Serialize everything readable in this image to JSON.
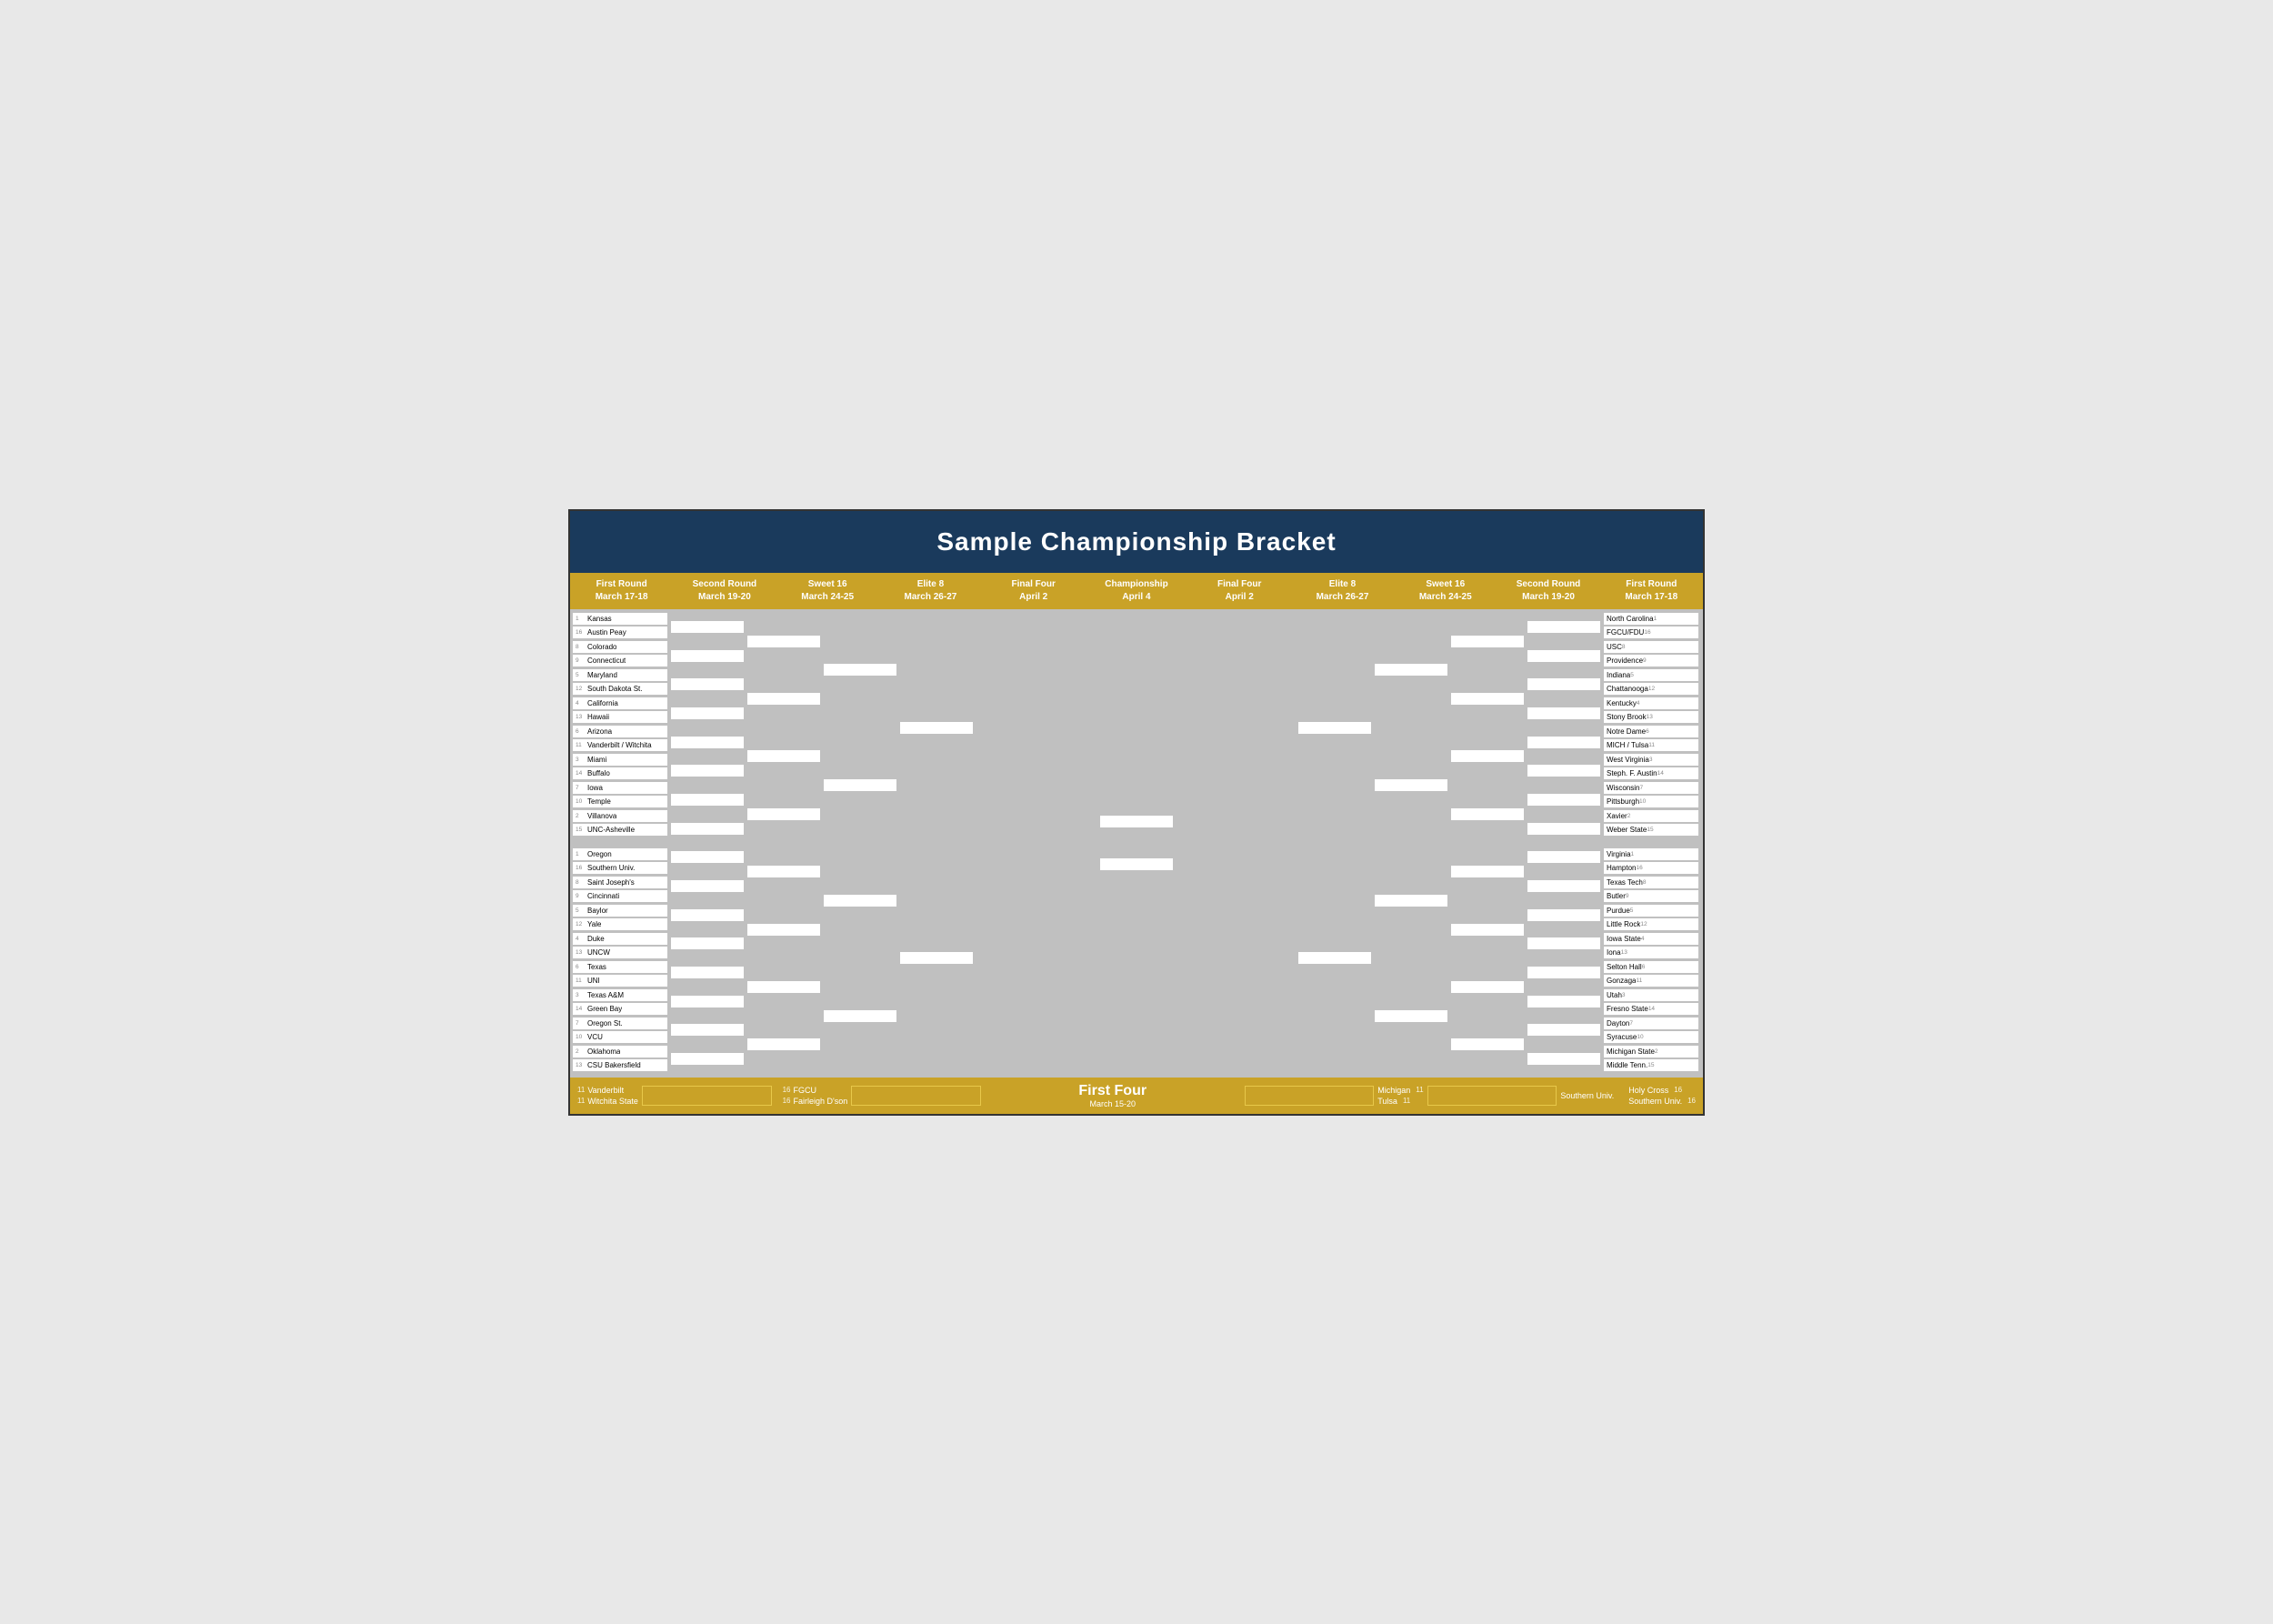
{
  "title": "Sample Championship Bracket",
  "rounds": {
    "left": [
      "First Round\nMarch 17-18",
      "Second Round\nMarch 19-20",
      "Sweet 16\nMarch 24-25",
      "Elite 8\nMarch 26-27",
      "Final Four\nApril 2",
      "Championship\nApril 4"
    ],
    "right": [
      "Final Four\nApril 2",
      "Elite 8\nMarch 26-27",
      "Sweet 16\nMarch 24-25",
      "Second Round\nMarch 19-20",
      "First Round\nMarch 17-18"
    ]
  },
  "left_top": [
    {
      "seed": 1,
      "name": "Kansas"
    },
    {
      "seed": 16,
      "name": "Austin Peay"
    },
    {
      "seed": 8,
      "name": "Colorado"
    },
    {
      "seed": 9,
      "name": "Connecticut"
    },
    {
      "seed": 5,
      "name": "Maryland"
    },
    {
      "seed": 12,
      "name": "South Dakota St."
    },
    {
      "seed": 4,
      "name": "California"
    },
    {
      "seed": 13,
      "name": "Hawaii"
    },
    {
      "seed": 6,
      "name": "Arizona"
    },
    {
      "seed": 11,
      "name": "Vanderbilt / Witchita"
    },
    {
      "seed": 3,
      "name": "Miami"
    },
    {
      "seed": 14,
      "name": "Buffalo"
    },
    {
      "seed": 7,
      "name": "Iowa"
    },
    {
      "seed": 10,
      "name": "Temple"
    },
    {
      "seed": 2,
      "name": "Villanova"
    },
    {
      "seed": 15,
      "name": "UNC-Asheville"
    }
  ],
  "left_bottom": [
    {
      "seed": 1,
      "name": "Oregon"
    },
    {
      "seed": 16,
      "name": "Southern Univ."
    },
    {
      "seed": 8,
      "name": "Saint Joseph's"
    },
    {
      "seed": 9,
      "name": "Cincinnati"
    },
    {
      "seed": 5,
      "name": "Baylor"
    },
    {
      "seed": 12,
      "name": "Yale"
    },
    {
      "seed": 4,
      "name": "Duke"
    },
    {
      "seed": 13,
      "name": "UNCW"
    },
    {
      "seed": 6,
      "name": "Texas"
    },
    {
      "seed": 11,
      "name": "UNI"
    },
    {
      "seed": 3,
      "name": "Texas A&M"
    },
    {
      "seed": 14,
      "name": "Green Bay"
    },
    {
      "seed": 7,
      "name": "Oregon St."
    },
    {
      "seed": 10,
      "name": "VCU"
    },
    {
      "seed": 2,
      "name": "Oklahoma"
    },
    {
      "seed": 13,
      "name": "CSU Bakersfield"
    }
  ],
  "right_top": [
    {
      "seed": 1,
      "name": "North Carolina"
    },
    {
      "seed": 16,
      "name": "FGCU/FDU"
    },
    {
      "seed": 8,
      "name": "USC"
    },
    {
      "seed": 9,
      "name": "Providence"
    },
    {
      "seed": 5,
      "name": "Indiana"
    },
    {
      "seed": 12,
      "name": "Chattanooga"
    },
    {
      "seed": 4,
      "name": "Kentucky"
    },
    {
      "seed": 13,
      "name": "Stony Brook"
    },
    {
      "seed": 6,
      "name": "Notre Dame"
    },
    {
      "seed": 11,
      "name": "MICH / Tulsa"
    },
    {
      "seed": 3,
      "name": "West Virginia"
    },
    {
      "seed": 14,
      "name": "Steph. F. Austin"
    },
    {
      "seed": 7,
      "name": "Wisconsin"
    },
    {
      "seed": 10,
      "name": "Pittsburgh"
    },
    {
      "seed": 2,
      "name": "Xavier"
    },
    {
      "seed": 15,
      "name": "Weber State"
    }
  ],
  "right_bottom": [
    {
      "seed": 1,
      "name": "Virginia"
    },
    {
      "seed": 16,
      "name": "Hampton"
    },
    {
      "seed": 8,
      "name": "Texas Tech"
    },
    {
      "seed": 9,
      "name": "Butler"
    },
    {
      "seed": 5,
      "name": "Purdue"
    },
    {
      "seed": 12,
      "name": "Little Rock"
    },
    {
      "seed": 4,
      "name": "Iowa State"
    },
    {
      "seed": 13,
      "name": "Iona"
    },
    {
      "seed": 6,
      "name": "Selton Hall"
    },
    {
      "seed": 11,
      "name": "Gonzaga"
    },
    {
      "seed": 3,
      "name": "Utah"
    },
    {
      "seed": 14,
      "name": "Fresno State"
    },
    {
      "seed": 7,
      "name": "Dayton"
    },
    {
      "seed": 10,
      "name": "Syracuse"
    },
    {
      "seed": 2,
      "name": "Michigan State"
    },
    {
      "seed": 15,
      "name": "Middle Tenn."
    }
  ],
  "first_four": {
    "title": "First Four",
    "dates": "March 15-20",
    "left_teams": [
      {
        "seed": 11,
        "name": "Vanderbilt"
      },
      {
        "seed": 11,
        "name": "Witchita State"
      }
    ],
    "left2_teams": [
      {
        "seed": 16,
        "name": "FGCU"
      },
      {
        "seed": 16,
        "name": "Fairleigh D'son"
      }
    ],
    "right_teams": [
      {
        "seed": 11,
        "name": "Michigan"
      },
      {
        "seed": 11,
        "name": "Tulsa"
      }
    ],
    "right2_teams": [
      {
        "name": "Southern Univ."
      }
    ],
    "far_right": [
      {
        "seed": 16,
        "name": "Holy Cross"
      },
      {
        "seed": 16,
        "name": "Southern Univ."
      }
    ]
  }
}
